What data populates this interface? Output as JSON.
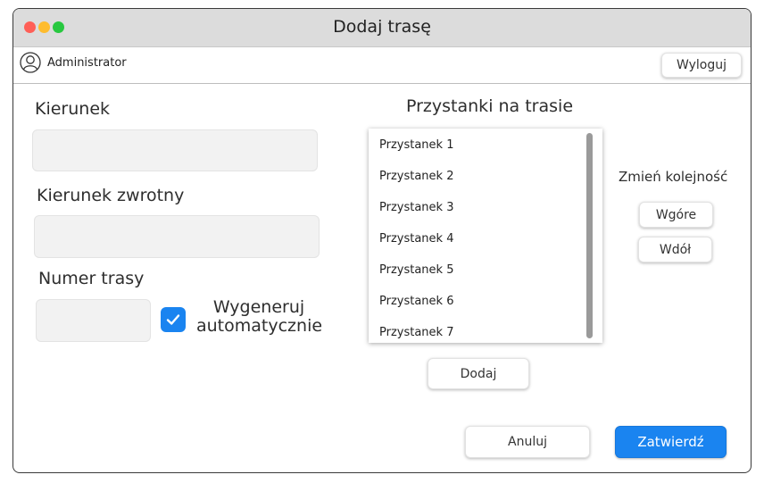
{
  "window": {
    "title": "Dodaj trasę"
  },
  "user": {
    "name": "Administrator",
    "logout_label": "Wyloguj",
    "icon": "user-icon"
  },
  "form": {
    "direction_label": "Kierunek",
    "direction_value": "",
    "return_direction_label": "Kierunek zwrotny",
    "return_direction_value": "",
    "route_number_label": "Numer trasy",
    "route_number_value": "",
    "auto_generate_line1": "Wygeneruj",
    "auto_generate_line2": "automatycznie",
    "auto_generate_checked": true
  },
  "stops": {
    "title": "Przystanki na trasie",
    "items": [
      "Przystanek 1",
      "Przystanek 2",
      "Przystanek 3",
      "Przystanek 4",
      "Przystanek 5",
      "Przystanek 6",
      "Przystanek 7"
    ],
    "add_label": "Dodaj",
    "reorder_title": "Zmień kolejność",
    "up_label": "Wgóre",
    "down_label": "Wdół"
  },
  "actions": {
    "cancel_label": "Anuluj",
    "confirm_label": "Zatwierdź"
  },
  "colors": {
    "accent": "#1a84f0",
    "titlebar": "#dcdcdc",
    "input_bg": "#f2f2f2"
  }
}
